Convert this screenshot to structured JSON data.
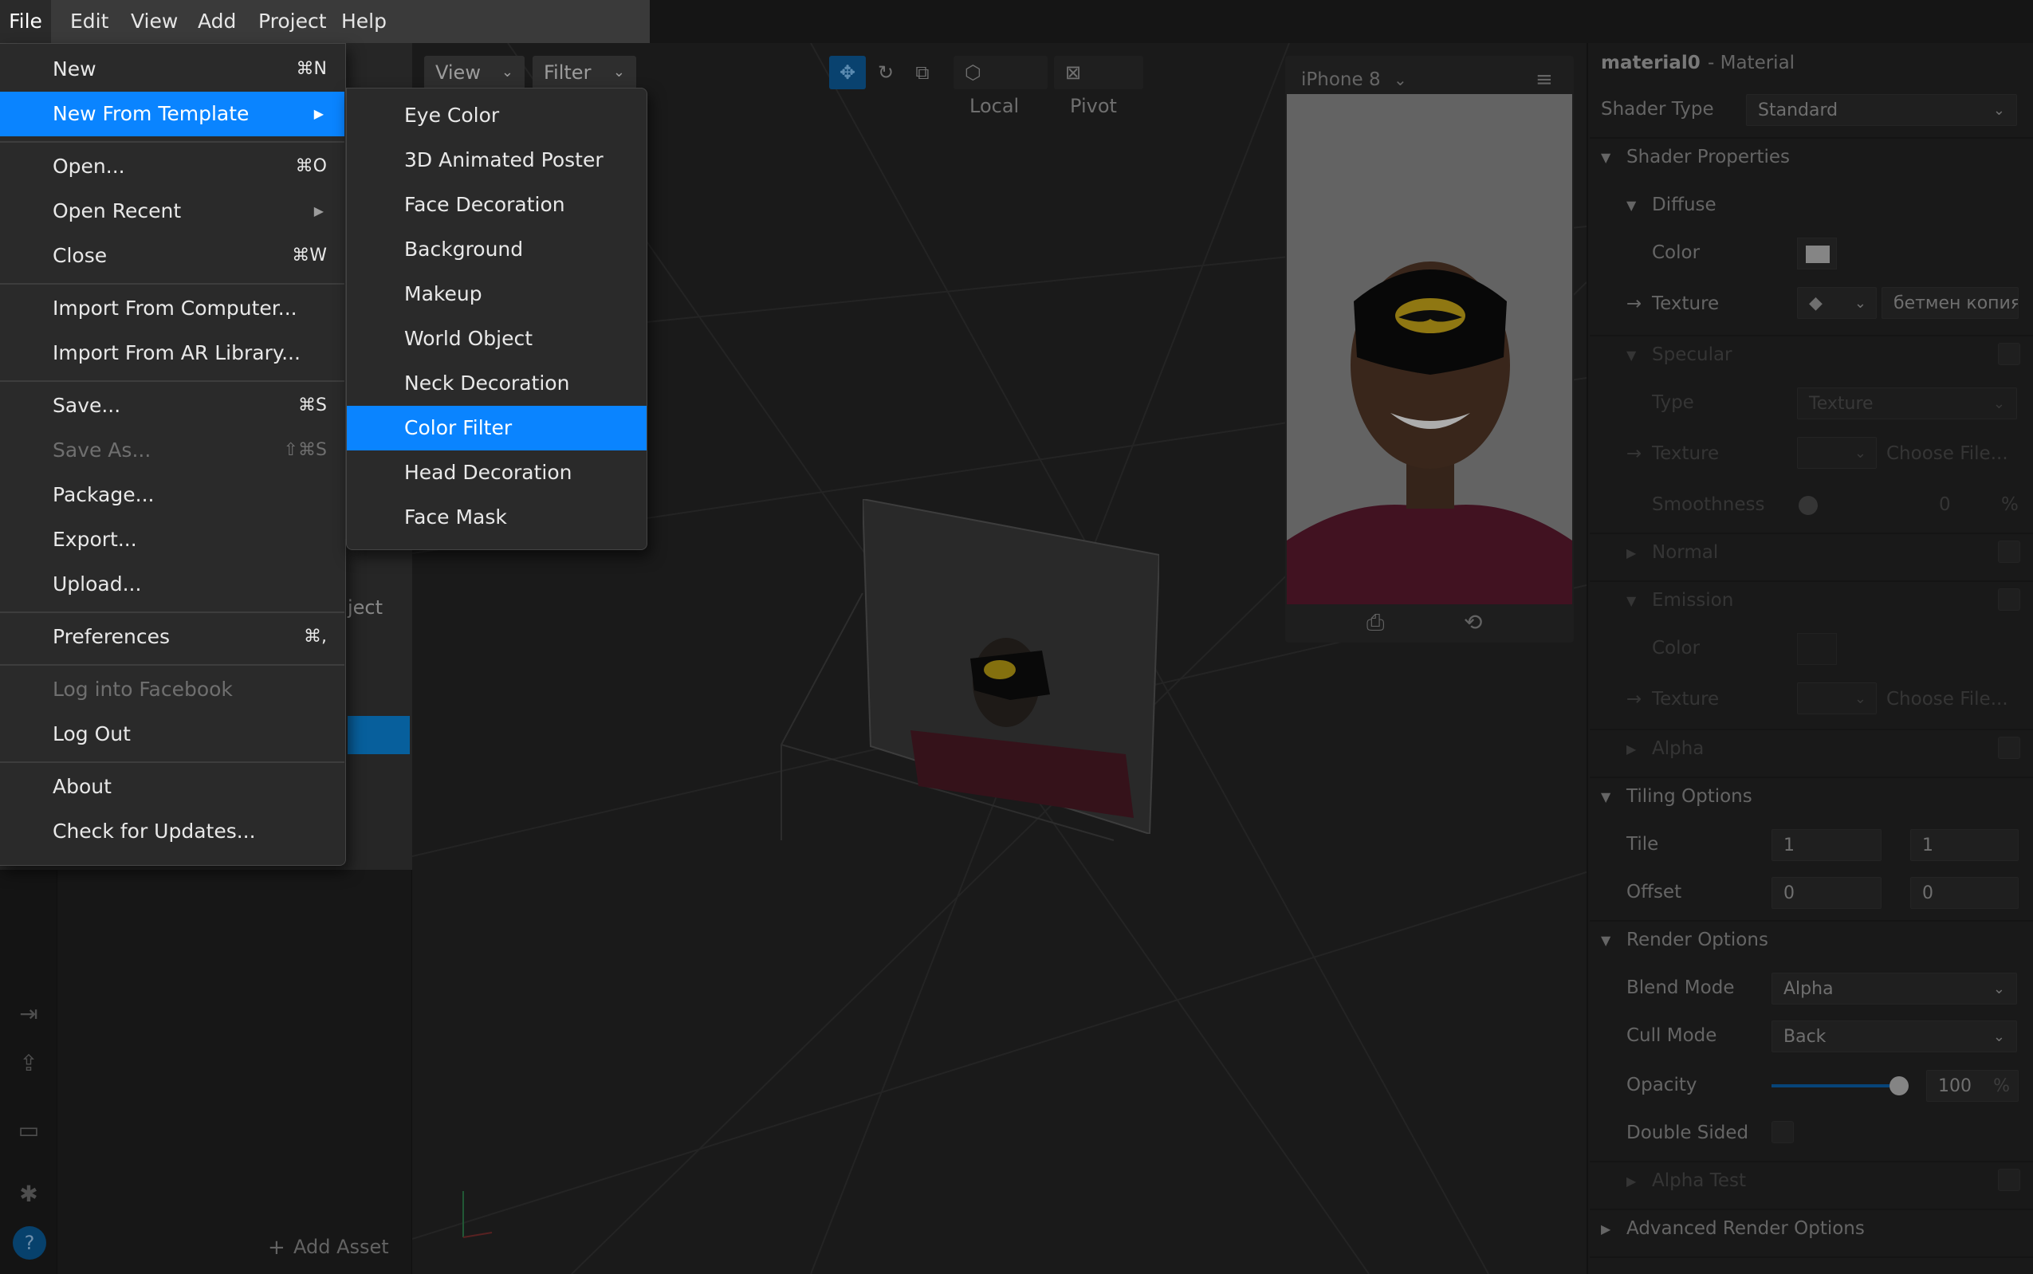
{
  "menubar": {
    "items": [
      "File",
      "Edit",
      "View",
      "Add",
      "Project",
      "Help"
    ]
  },
  "file_menu": {
    "items": [
      {
        "label": "New",
        "shortcut": "⌘N"
      },
      {
        "label": "New From Template",
        "submenu": true
      },
      {
        "label": "Open...",
        "shortcut": "⌘O"
      },
      {
        "label": "Open Recent",
        "submenu": true
      },
      {
        "label": "Close",
        "shortcut": "⌘W"
      },
      {
        "label": "Import From Computer..."
      },
      {
        "label": "Import From AR Library..."
      },
      {
        "label": "Save...",
        "shortcut": "⌘S"
      },
      {
        "label": "Save As...",
        "shortcut": "⇧⌘S",
        "disabled": true
      },
      {
        "label": "Package..."
      },
      {
        "label": "Export..."
      },
      {
        "label": "Upload..."
      },
      {
        "label": "Preferences",
        "shortcut": "⌘,"
      },
      {
        "label": "Log into Facebook",
        "disabled": true
      },
      {
        "label": "Log Out"
      },
      {
        "label": "About"
      },
      {
        "label": "Check for Updates..."
      }
    ]
  },
  "template_menu": {
    "items": [
      "Eye Color",
      "3D Animated Poster",
      "Face Decoration",
      "Background",
      "Makeup",
      "World Object",
      "Neck Decoration",
      "Color Filter",
      "Head Decoration",
      "Face Mask"
    ],
    "active": "Color Filter"
  },
  "scene_panel": {
    "partial_text": "ject",
    "add_asset": "Add Asset"
  },
  "viewport_toolbar": {
    "view": "View",
    "filter": "Filter",
    "local": "Local",
    "pivot": "Pivot"
  },
  "simulator": {
    "device": "iPhone 8"
  },
  "inspector": {
    "title": "material0",
    "type": "- Material",
    "shader_type_label": "Shader Type",
    "shader_type_value": "Standard",
    "shader_properties": "Shader Properties",
    "diffuse": "Diffuse",
    "color": "Color",
    "texture": "Texture",
    "diffuse_texture_file": "бетмен копия",
    "specular": "Specular",
    "type_label": "Type",
    "type_value": "Texture",
    "choose_file": "Choose File...",
    "smoothness": "Smoothness",
    "smoothness_value": "0",
    "percent": "%",
    "normal": "Normal",
    "emission": "Emission",
    "alpha": "Alpha",
    "tiling_options": "Tiling Options",
    "tile": "Tile",
    "tile_x": "1",
    "tile_y": "1",
    "offset": "Offset",
    "offset_x": "0",
    "offset_y": "0",
    "render_options": "Render Options",
    "blend_mode": "Blend Mode",
    "blend_mode_value": "Alpha",
    "cull_mode": "Cull Mode",
    "cull_mode_value": "Back",
    "opacity": "Opacity",
    "opacity_value": "100",
    "double_sided": "Double Sided",
    "alpha_test": "Alpha Test",
    "advanced_render_options": "Advanced Render Options"
  },
  "colors": {
    "accent": "#0a84ff",
    "menu_bg": "#2a2a2a"
  }
}
